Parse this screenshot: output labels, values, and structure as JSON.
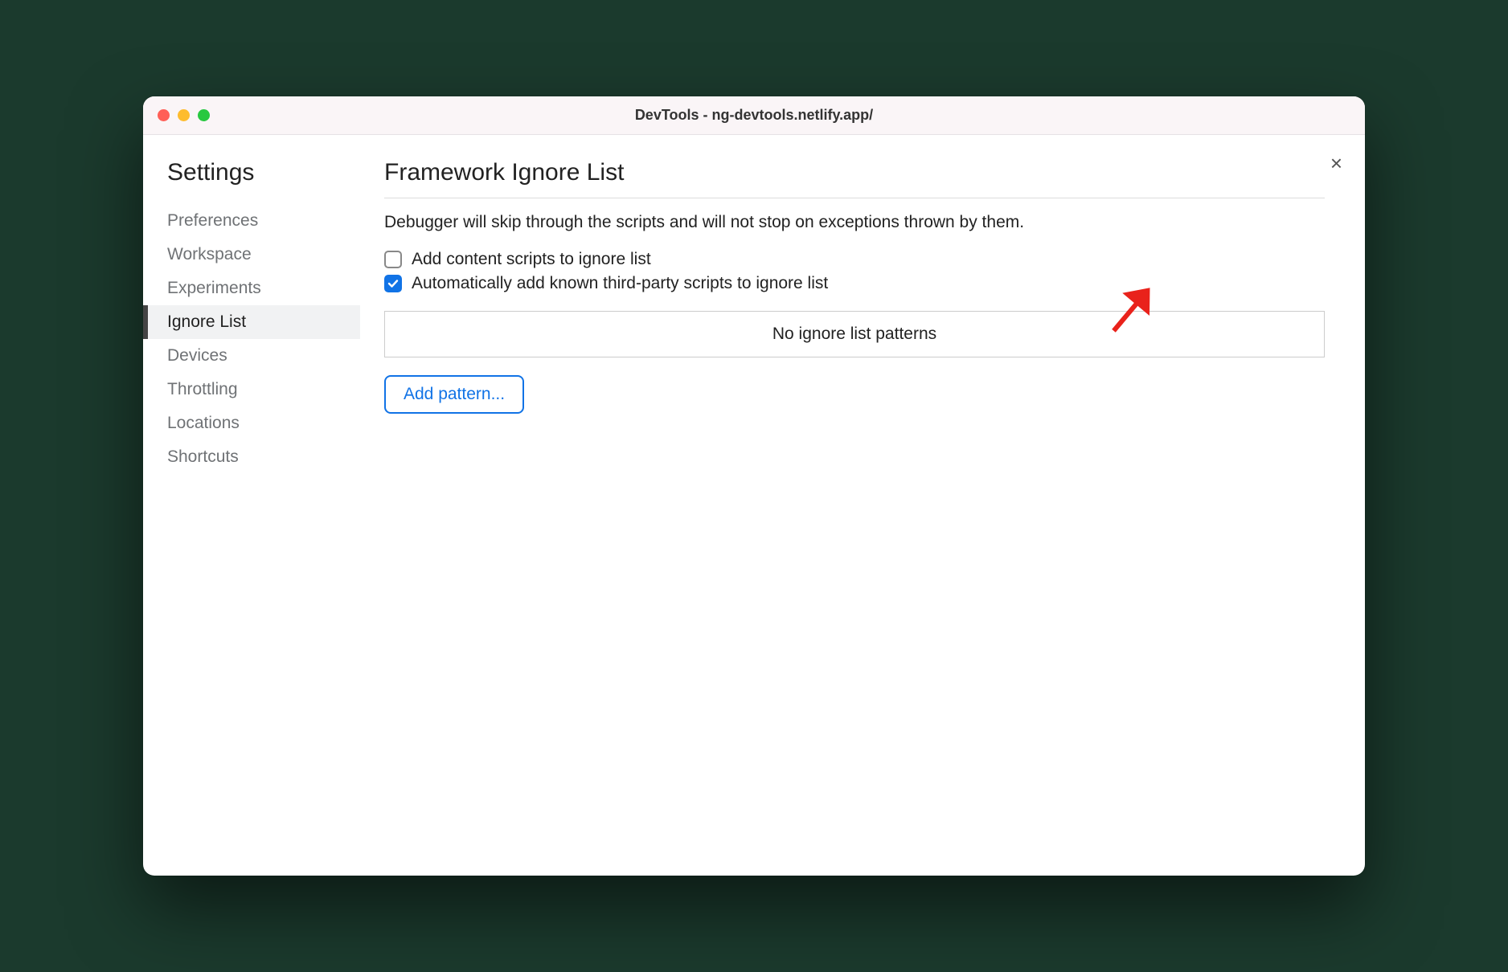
{
  "window": {
    "title": "DevTools - ng-devtools.netlify.app/"
  },
  "sidebar": {
    "heading": "Settings",
    "items": [
      {
        "label": "Preferences",
        "active": false
      },
      {
        "label": "Workspace",
        "active": false
      },
      {
        "label": "Experiments",
        "active": false
      },
      {
        "label": "Ignore List",
        "active": true
      },
      {
        "label": "Devices",
        "active": false
      },
      {
        "label": "Throttling",
        "active": false
      },
      {
        "label": "Locations",
        "active": false
      },
      {
        "label": "Shortcuts",
        "active": false
      }
    ]
  },
  "main": {
    "heading": "Framework Ignore List",
    "description": "Debugger will skip through the scripts and will not stop on exceptions thrown by them.",
    "checkboxes": [
      {
        "label": "Add content scripts to ignore list",
        "checked": false
      },
      {
        "label": "Automatically add known third-party scripts to ignore list",
        "checked": true
      }
    ],
    "patterns_empty_label": "No ignore list patterns",
    "add_button_label": "Add pattern...",
    "close_label": "×"
  }
}
